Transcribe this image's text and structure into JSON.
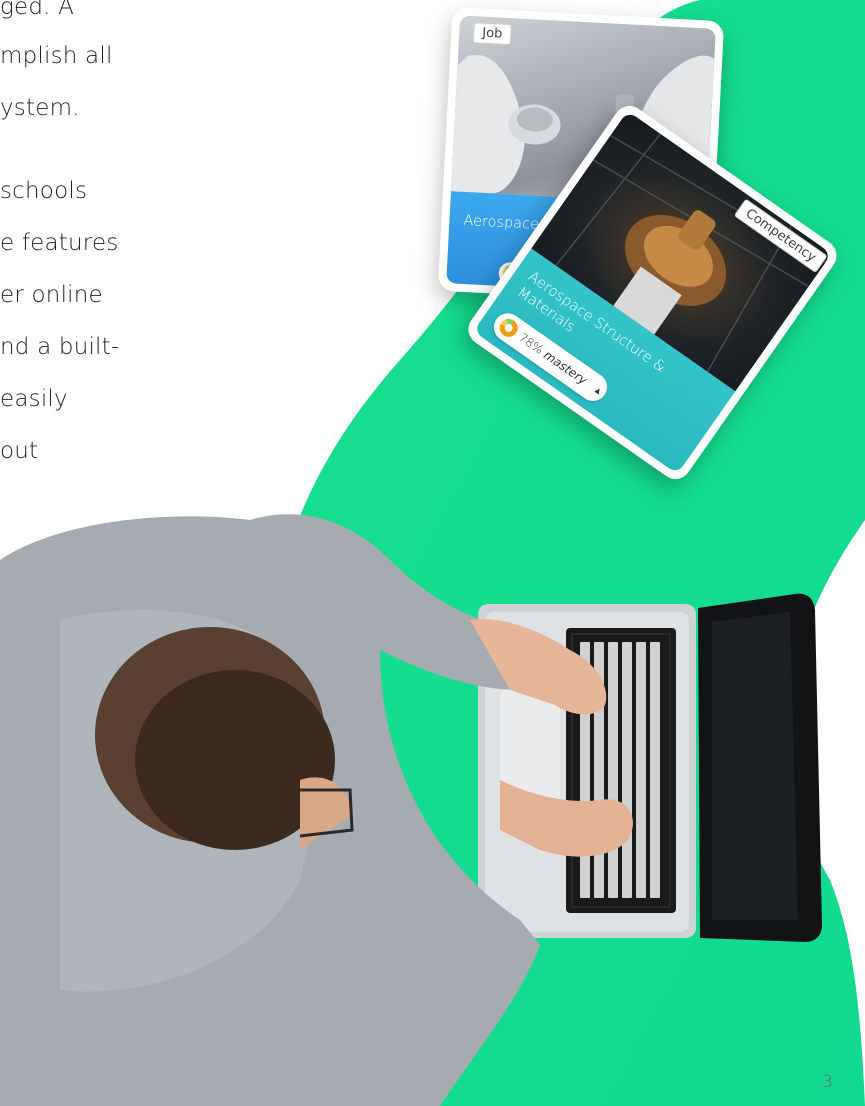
{
  "body_text_lines": [
    "ged. A",
    "mplish all",
    "ystem.",
    "",
    "schools",
    "e features",
    "er online",
    "nd a built-",
    "easily",
    "out"
  ],
  "cards": {
    "job": {
      "tag": "Job",
      "title": "Aerospace En"
    },
    "competency": {
      "tag": "Competency",
      "title": "Aerospace Structure & Materials",
      "mastery_percent": "78%",
      "mastery_word": "mastery",
      "mastery_value": 0.78,
      "dropdown_icon": "caret-up-icon"
    }
  },
  "page_number": "3",
  "colors": {
    "green_shape": "#16e28c",
    "job_band": "#3aa8ee",
    "competency_band": "#2ab9c0",
    "text": "#222222"
  }
}
